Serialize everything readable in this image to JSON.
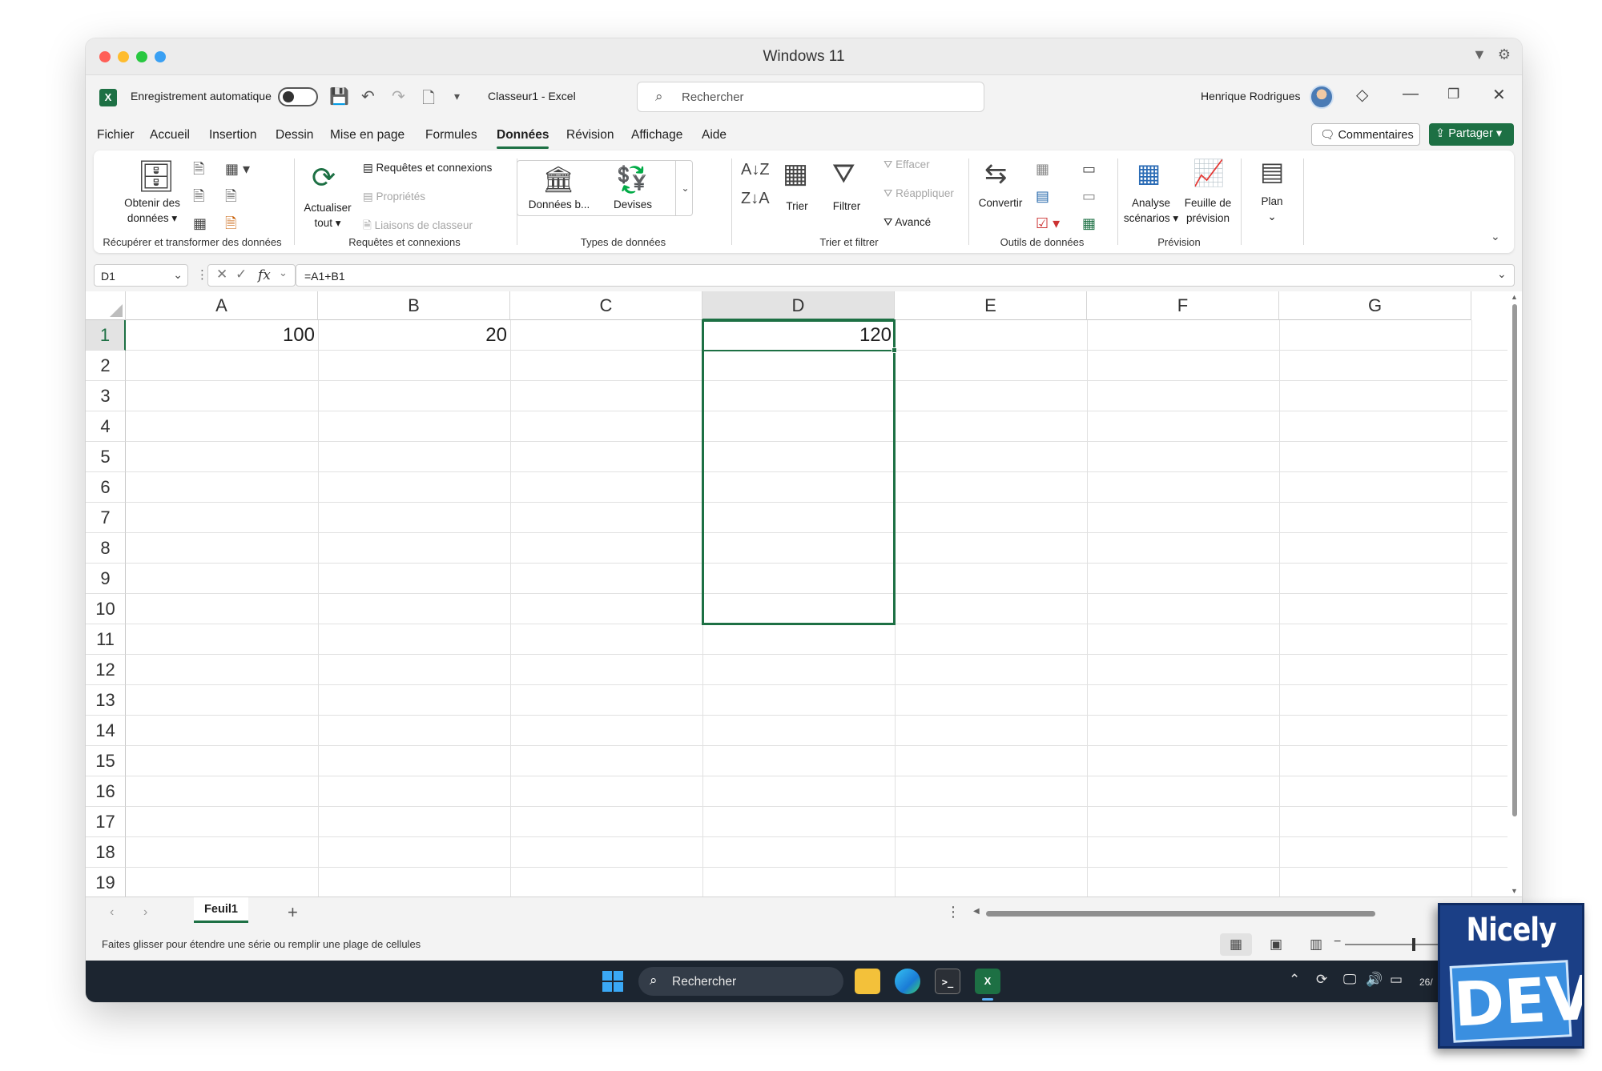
{
  "window": {
    "title": "Windows 11"
  },
  "excel": {
    "logo": "X",
    "autosave_label": "Enregistrement automatique",
    "doc_title": "Classeur1  -  Excel",
    "search_placeholder": "Rechercher",
    "user_name": "Henrique Rodrigues"
  },
  "menu": {
    "tabs": [
      "Fichier",
      "Accueil",
      "Insertion",
      "Dessin",
      "Mise en page",
      "Formules",
      "Données",
      "Révision",
      "Affichage",
      "Aide"
    ],
    "active_tab": "Données",
    "comments_label": "Commentaires",
    "share_label": "Partager"
  },
  "ribbon": {
    "get_data": {
      "label_1": "Obtenir des",
      "label_2": "données",
      "group": "Récupérer et transformer des données"
    },
    "queries": {
      "refresh_1": "Actualiser",
      "refresh_2": "tout",
      "queries_connections": "Requêtes et connexions",
      "properties": "Propriétés",
      "workbook_links": "Liaisons de classeur",
      "group": "Requêtes et connexions"
    },
    "data_types": {
      "stocks": "Données b...",
      "currencies": "Devises",
      "group": "Types de données"
    },
    "sort_filter": {
      "sort": "Trier",
      "filter": "Filtrer",
      "clear": "Effacer",
      "reapply": "Réappliquer",
      "advanced": "Avancé",
      "group": "Trier et filtrer"
    },
    "data_tools": {
      "convert": "Convertir",
      "group": "Outils de données"
    },
    "forecast": {
      "whatif_1": "Analyse",
      "whatif_2": "scénarios",
      "sheet_1": "Feuille de",
      "sheet_2": "prévision",
      "group": "Prévision"
    },
    "outline": {
      "label": "Plan"
    }
  },
  "formula_bar": {
    "name_box": "D1",
    "fx": "fx",
    "formula": "=A1+B1"
  },
  "grid": {
    "columns": [
      "A",
      "B",
      "C",
      "D",
      "E",
      "F",
      "G"
    ],
    "rows": [
      "1",
      "2",
      "3",
      "4",
      "5",
      "6",
      "7",
      "8",
      "9",
      "10",
      "11",
      "12",
      "13",
      "14",
      "15",
      "16",
      "17",
      "18",
      "19"
    ],
    "selected_column": "D",
    "active_row": "1",
    "cells": {
      "A1": "100",
      "B1": "20",
      "D1": "120"
    }
  },
  "sheets": {
    "tabs": [
      "Feuil1"
    ],
    "add": "+"
  },
  "status": {
    "message": "Faites glisser pour étendre une série ou remplir une plage de cellules"
  },
  "taskbar": {
    "search_placeholder": "Rechercher",
    "date": "26/"
  },
  "badge": {
    "line1": "Nicely",
    "line2": "DEV"
  }
}
